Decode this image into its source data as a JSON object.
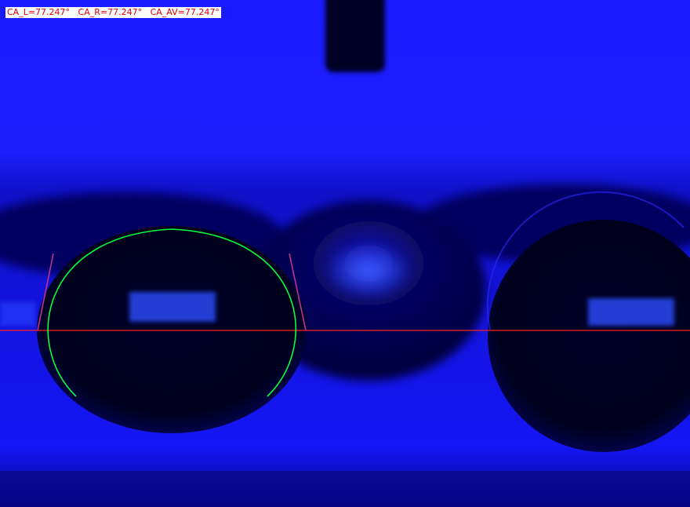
{
  "measurement": {
    "readout_text": "CA_L=77.247°   CA_R=77.247°   CA_AV=77.247°",
    "contact_angle_left_deg": 77.247,
    "contact_angle_right_deg": 77.247,
    "contact_angle_avg_deg": 77.247
  },
  "colors": {
    "background": "#1b1bff",
    "droplet": "#000018",
    "baseline": "#ff2020",
    "fit_curve": "#00ff40",
    "tangent": "#c0308a",
    "readout_text": "#e00000"
  }
}
